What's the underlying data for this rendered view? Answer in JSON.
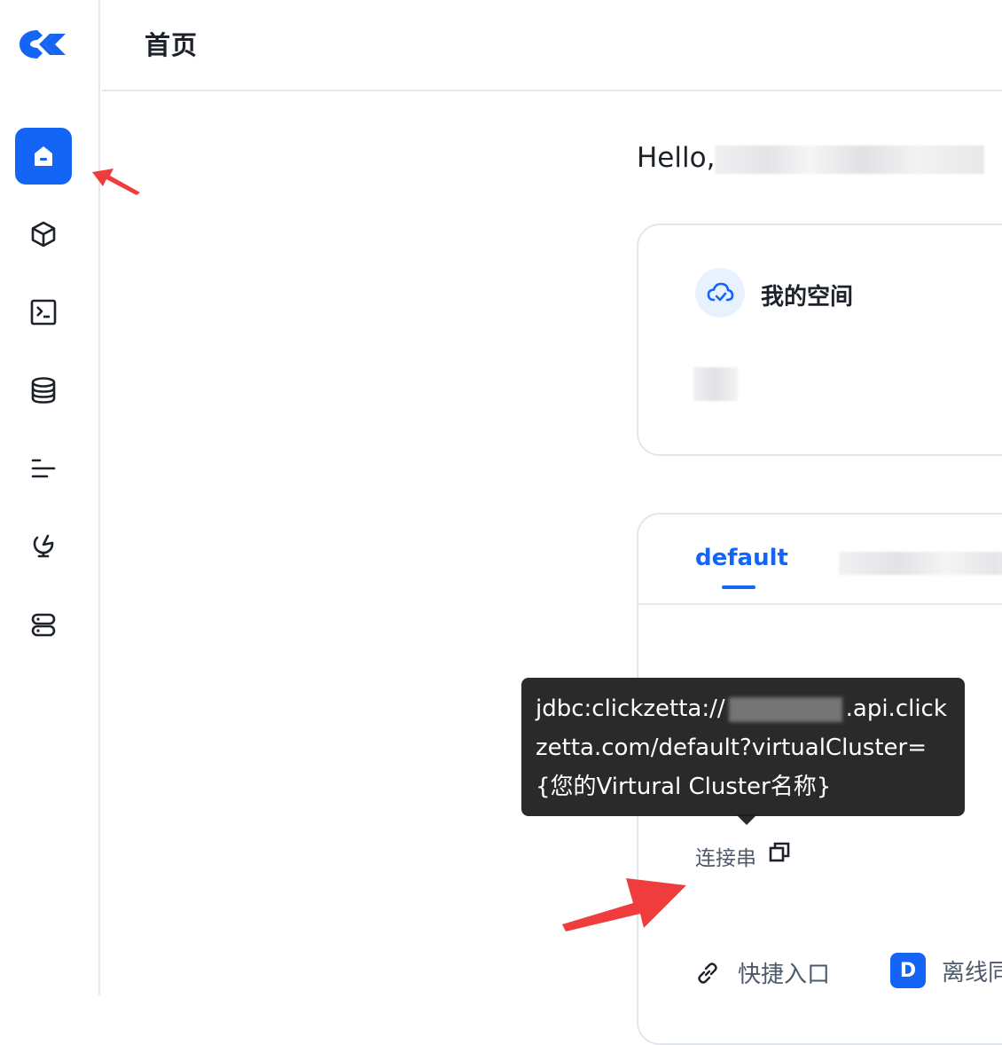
{
  "header": {
    "title": "首页"
  },
  "sidebar": {
    "logo": "clickzetta-logo",
    "items": [
      {
        "icon": "home-icon",
        "active": true
      },
      {
        "icon": "cube-icon",
        "active": false
      },
      {
        "icon": "terminal-icon",
        "active": false
      },
      {
        "icon": "database-icon",
        "active": false
      },
      {
        "icon": "task-list-icon",
        "active": false
      },
      {
        "icon": "monitor-icon",
        "active": false
      },
      {
        "icon": "server-icon",
        "active": false
      }
    ]
  },
  "main": {
    "greeting": "Hello,",
    "my_space": {
      "title": "我的空间",
      "icon": "cloud-check-icon"
    },
    "cluster_card": {
      "tabs": [
        {
          "label": "default",
          "active": true
        }
      ],
      "connection_label": "连接串",
      "quick_entry": "快捷入口",
      "offline_sync_badge": "D",
      "offline_sync": "离线同"
    },
    "tooltip": {
      "lines": [
        "jdbc:clickzetta://",
        ".api.click",
        "zetta.com/default?virtualCluster=",
        "{您的Virtural Cluster名称}"
      ]
    }
  },
  "colors": {
    "accent": "#1464f6",
    "annotation": "#ef3c3c",
    "tooltip_bg": "#1d1d1d"
  }
}
